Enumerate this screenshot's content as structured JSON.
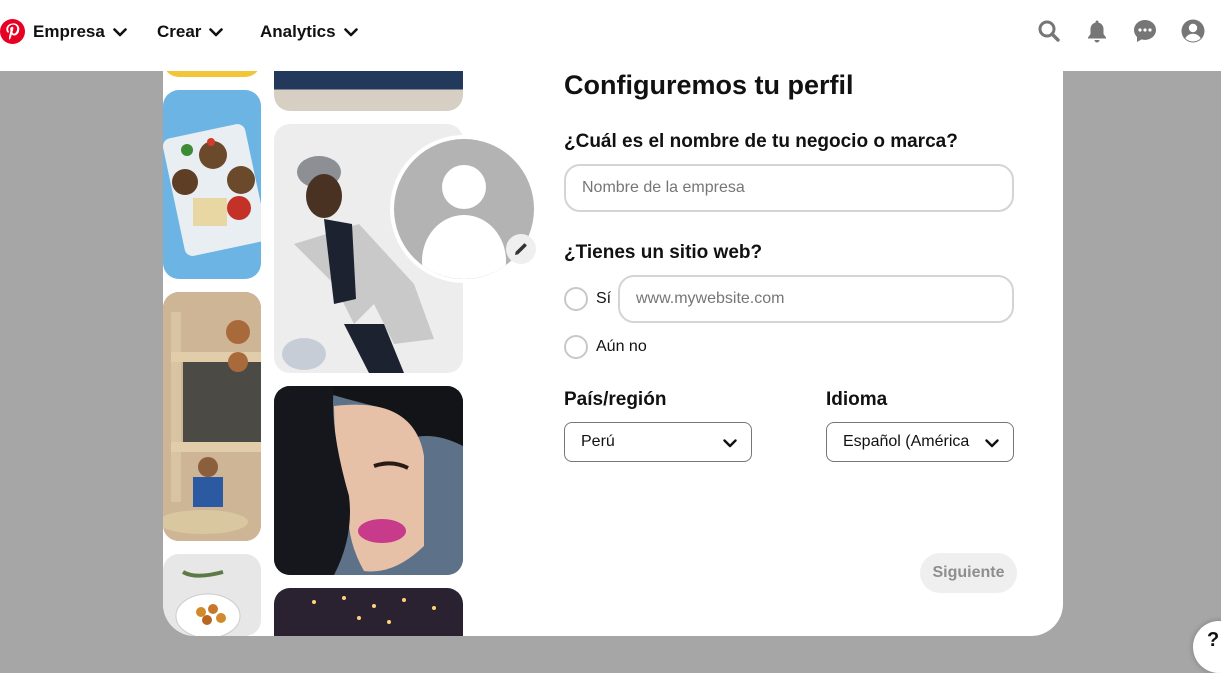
{
  "header": {
    "nav": [
      {
        "label": "Empresa"
      },
      {
        "label": "Crear"
      },
      {
        "label": "Analytics"
      }
    ],
    "icons": [
      "search-icon",
      "bell-icon",
      "messages-icon",
      "profile-icon"
    ],
    "brand_color": "#e60023"
  },
  "form": {
    "title": "Configuremos tu perfil",
    "business_label": "¿Cuál es el nombre de tu negocio o marca?",
    "business_placeholder": "Nombre de la empresa",
    "website_label": "¿Tienes un sitio web?",
    "website_yes": "Sí",
    "website_placeholder": "www.mywebsite.com",
    "website_no": "Aún no",
    "country_label": "País/región",
    "country_value": "Perú",
    "language_label": "Idioma",
    "language_value": "Español (América",
    "next_button": "Siguiente"
  },
  "help": {
    "label": "?"
  },
  "colors": {
    "backdrop": "#a6a6a6",
    "disabled_button_bg": "#efefef"
  }
}
